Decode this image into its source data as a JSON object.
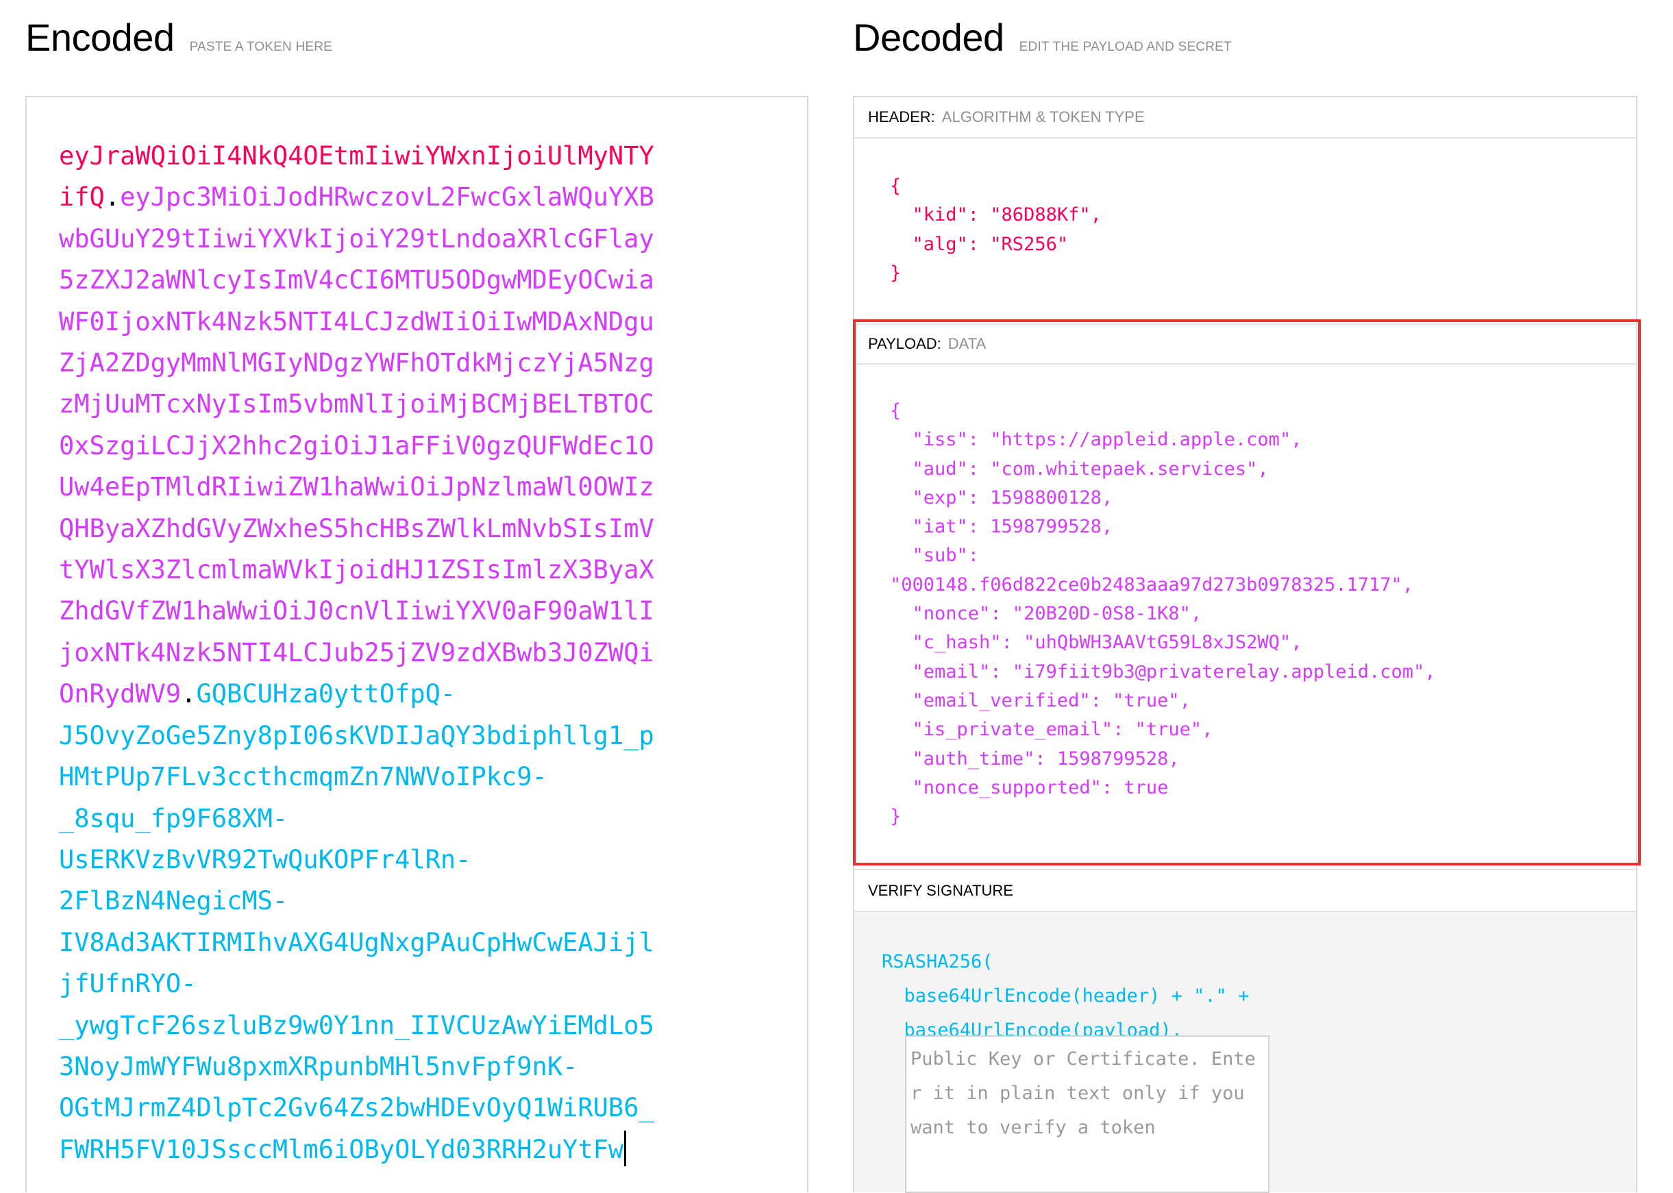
{
  "encoded": {
    "title": "Encoded",
    "subtitle": "PASTE A TOKEN HERE",
    "token_header_lines": [
      "eyJraWQiOiI4NkQ4OEtmIiwiYWxnIjoiUlMyNTY",
      "ifQ"
    ],
    "token_payload_lines": [
      "eyJpc3MiOiJodHRwczovL2FwcGxlaWQuYXB",
      "wbGUuY29tIiwiYXVkIjoiY29tLndoaXRlcGFlay",
      "5zZXJ2aWNlcyIsImV4cCI6MTU5ODgwMDEyOCwia",
      "WF0IjoxNTk4Nzk5NTI4LCJzdWIiOiIwMDAxNDgu",
      "ZjA2ZDgyMmNlMGIyNDgzYWFhOTdkMjczYjA5Nzg",
      "zMjUuMTcxNyIsIm5vbmNlIjoiMjBCMjBELTBTOC",
      "0xSzgiLCJjX2hhc2giOiJ1aFFiV0gzQUFWdEc1O",
      "Uw4eEpTMldRIiwiZW1haWwiOiJpNzlmaWl0OWIz",
      "QHByaXZhdGVyZWxheS5hcHBsZWlkLmNvbSIsImV",
      "tYWlsX3ZlcmlmaWVkIjoidHJ1ZSIsImlzX3ByaX",
      "ZhdGVfZW1haWwiOiJ0cnVlIiwiYXV0aF90aW1lI",
      "joxNTk4Nzk5NTI4LCJub25jZV9zdXBwb3J0ZWQi",
      "OnRydWV9"
    ],
    "token_signature_lines": [
      "GQBCUHza0yttOfpQ-",
      "J5OvyZoGe5Zny8pI06sKVDIJaQY3bdiphllg1_p",
      "HMtPUp7FLv3ccthcmqmZn7NWVoIPkc9-",
      "_8squ_fp9F68XM-",
      "UsERKVzBvVR92TwQuKOPFr4lRn-",
      "2FlBzN4NegicMS-",
      "IV8Ad3AKTIRMIhvAXG4UgNxgPAuCpHwCwEAJijl",
      "jfUfnRYO-",
      "_ywgTcF26szluBz9w0Y1nn_IIVCUzAwYiEMdLo5",
      "3NoyJmWYFWu8pxmXRpunbMHl5nvFpf9nK-",
      "OGtMJrmZ4DlpTc2Gv64Zs2bwHDEvOyQ1WiRUB6_",
      "FWRH5FV10JSsccMlm6iOByOLYd03RRH2uYtFw"
    ]
  },
  "decoded": {
    "title": "Decoded",
    "subtitle": "EDIT THE PAYLOAD AND SECRET",
    "header_section": {
      "label": "HEADER:",
      "sublabel": "ALGORITHM & TOKEN TYPE",
      "json": "{\n  \"kid\": \"86D88Kf\",\n  \"alg\": \"RS256\"\n}"
    },
    "payload_section": {
      "label": "PAYLOAD:",
      "sublabel": "DATA",
      "json": "{\n  \"iss\": \"https://appleid.apple.com\",\n  \"aud\": \"com.whitepaek.services\",\n  \"exp\": 1598800128,\n  \"iat\": 1598799528,\n  \"sub\":\n\"000148.f06d822ce0b2483aaa97d273b0978325.1717\",\n  \"nonce\": \"20B20D-0S8-1K8\",\n  \"c_hash\": \"uhQbWH3AAVtG59L8xJS2WQ\",\n  \"email\": \"i79fiit9b3@privaterelay.appleid.com\",\n  \"email_verified\": \"true\",\n  \"is_private_email\": \"true\",\n  \"auth_time\": 1598799528,\n  \"nonce_supported\": true\n}"
    },
    "verify_section": {
      "label": "VERIFY SIGNATURE",
      "code": "RSASHA256(\n  base64UrlEncode(header) + \".\" +\n  base64UrlEncode(payload),",
      "public_key_placeholder": "Public Key or Certificate. Enter it in plain text only if you want to verify a token"
    }
  },
  "colors": {
    "header": "#fb015b",
    "payload": "#d63aff",
    "signature": "#00b9f1",
    "highlight": "#e8312c"
  }
}
